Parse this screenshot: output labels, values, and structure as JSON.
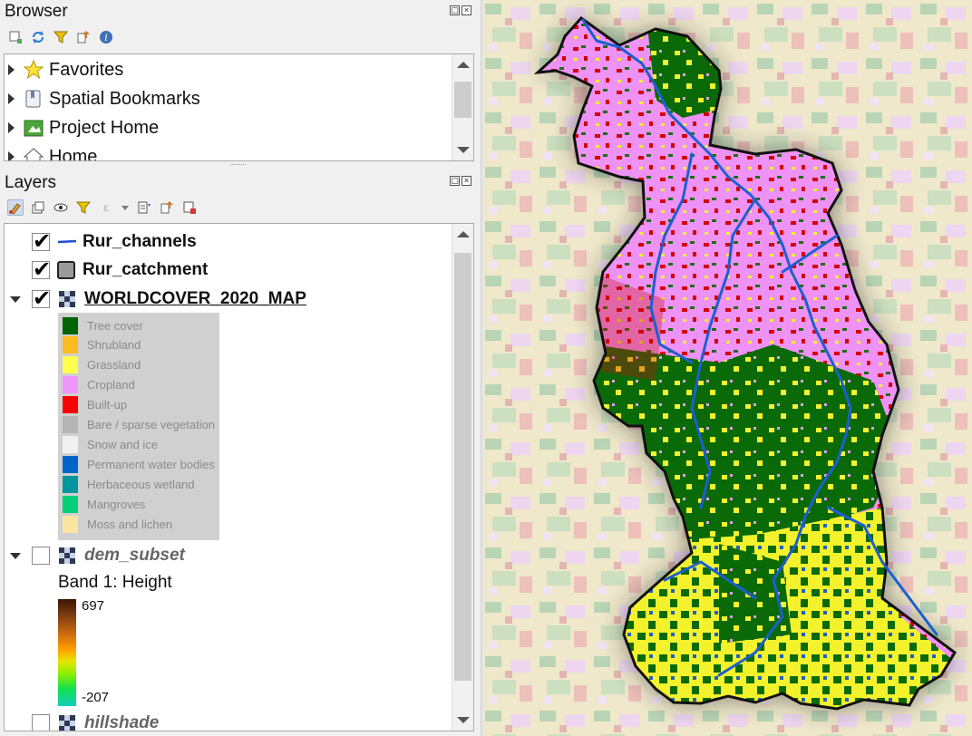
{
  "browser": {
    "title": "Browser",
    "items": [
      {
        "label": "Favorites",
        "icon": "star-icon"
      },
      {
        "label": "Spatial Bookmarks",
        "icon": "bookmark-icon"
      },
      {
        "label": "Project Home",
        "icon": "project-home-icon"
      },
      {
        "label": "Home",
        "icon": "home-icon"
      }
    ]
  },
  "layers": {
    "title": "Layers",
    "items": [
      {
        "name": "Rur_channels",
        "checked": true
      },
      {
        "name": "Rur_catchment",
        "checked": true
      },
      {
        "name": "WORLDCOVER_2020_MAP",
        "checked": true
      },
      {
        "name": "dem_subset",
        "checked": false
      },
      {
        "name": "hillshade",
        "checked": false
      }
    ],
    "worldcover_legend": [
      {
        "label": "Tree cover",
        "color": "#006400"
      },
      {
        "label": "Shrubland",
        "color": "#ffbb22"
      },
      {
        "label": "Grassland",
        "color": "#ffff4c"
      },
      {
        "label": "Cropland",
        "color": "#f096ff"
      },
      {
        "label": "Built-up",
        "color": "#fa0000"
      },
      {
        "label": "Bare / sparse vegetation",
        "color": "#b4b4b4"
      },
      {
        "label": "Snow and ice",
        "color": "#f0f0f0"
      },
      {
        "label": "Permanent water bodies",
        "color": "#0064c8"
      },
      {
        "label": "Herbaceous wetland",
        "color": "#0096a0"
      },
      {
        "label": "Mangroves",
        "color": "#00cf75"
      },
      {
        "label": "Moss and lichen",
        "color": "#fae6a0"
      }
    ],
    "dem": {
      "band_title": "Band 1: Height",
      "max": "697",
      "min": "-207"
    }
  }
}
